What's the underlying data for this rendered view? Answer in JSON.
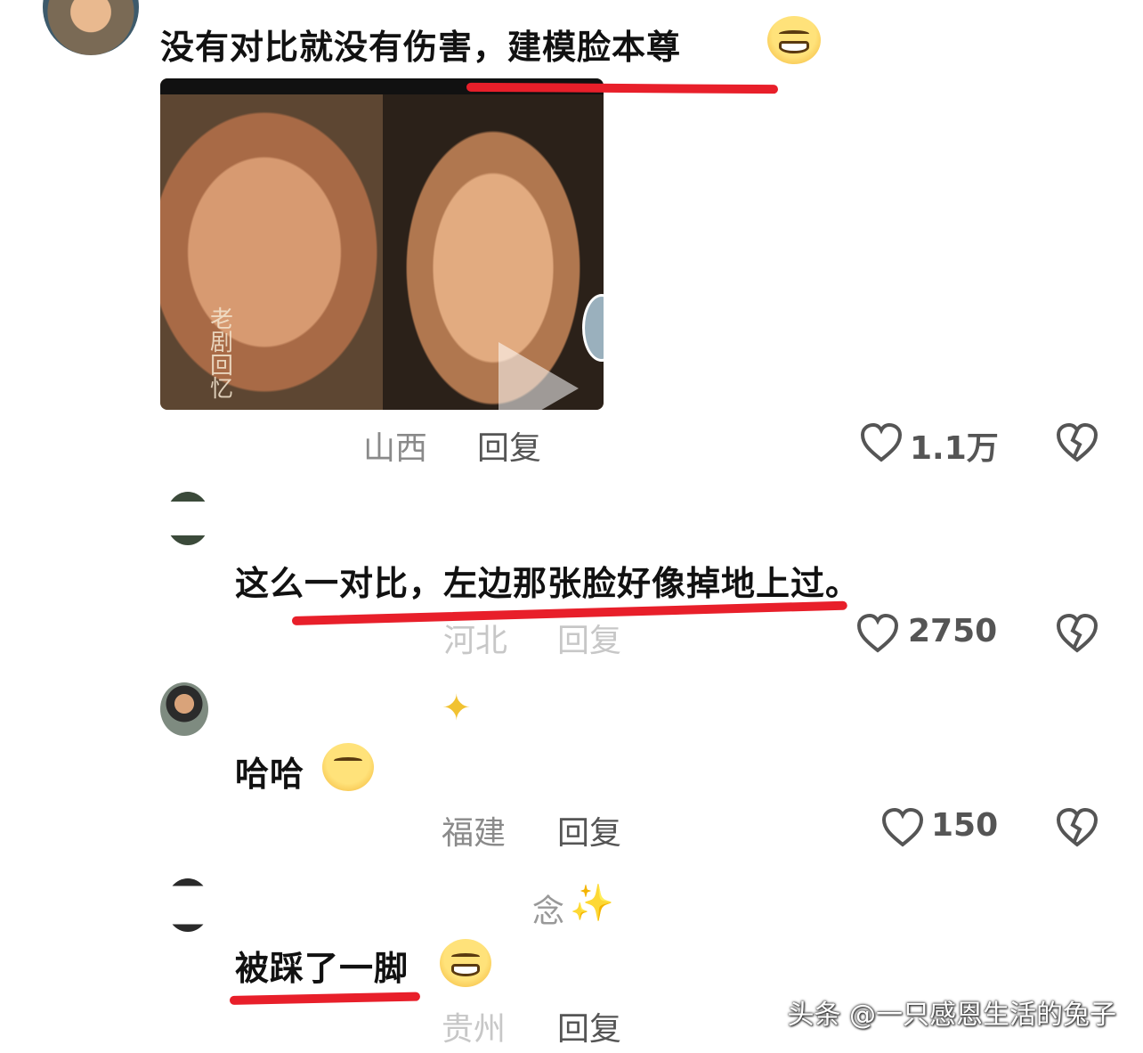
{
  "comments": [
    {
      "text": "没有对比就没有伤害，建模脸本尊",
      "location": "山西",
      "reply_label": "回复",
      "likes": "1.1万",
      "emoji": "grinning-face"
    },
    {
      "text": "这么一对比，左边那张脸好像掉地上过。",
      "location": "河北",
      "reply_label": "回复",
      "likes": "2750"
    },
    {
      "text": "哈哈",
      "location": "福建",
      "reply_label": "回复",
      "likes": "150",
      "emoji": "smirking-face"
    },
    {
      "username_fragment": "念",
      "text": "被踩了一脚",
      "location": "贵州",
      "reply_label": "回复",
      "emoji": "laughing-crying-face"
    }
  ],
  "video": {
    "watermark": "老剧回忆"
  },
  "watermark": "头条 @一只感恩生活的兔子",
  "colors": {
    "highlight": "#e81f2a",
    "meta": "#8a8a8a"
  }
}
